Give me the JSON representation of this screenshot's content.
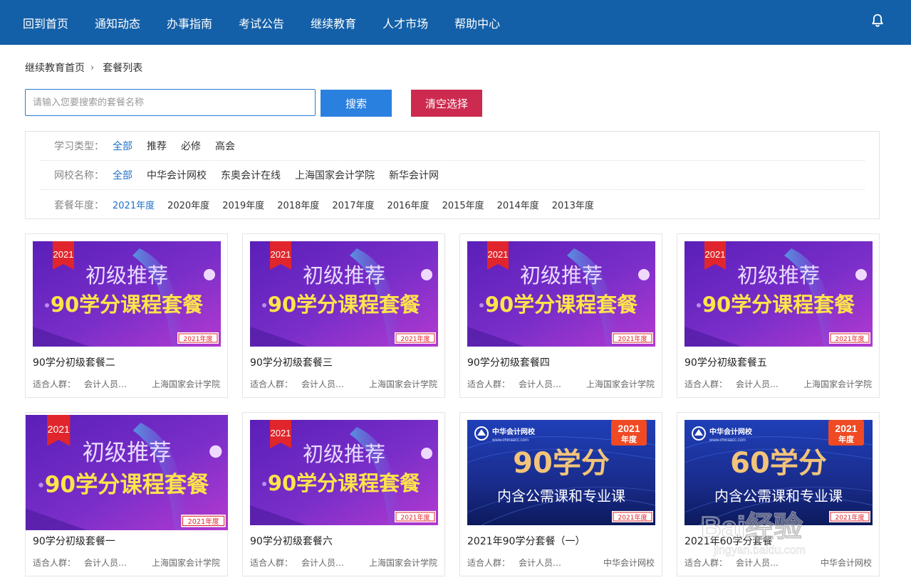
{
  "nav": {
    "items": [
      "回到首页",
      "通知动态",
      "办事指南",
      "考试公告",
      "继续教育",
      "人才市场",
      "帮助中心"
    ]
  },
  "breadcrumb": {
    "home": "继续教育首页",
    "current": "套餐列表"
  },
  "search": {
    "placeholder": "请输入您要搜索的套餐名称",
    "value": "",
    "button": "搜索",
    "clear": "清空选择"
  },
  "filters": {
    "type": {
      "label": "学习类型：",
      "options": [
        "全部",
        "推荐",
        "必修",
        "高会"
      ],
      "active": 0
    },
    "school": {
      "label": "网校名称：",
      "options": [
        "全部",
        "中华会计网校",
        "东奥会计在线",
        "上海国家会计学院",
        "新华会计网"
      ],
      "active": 0
    },
    "year": {
      "label": "套餐年度：",
      "options": [
        "2021年度",
        "2020年度",
        "2019年度",
        "2018年度",
        "2017年度",
        "2016年度",
        "2015年度",
        "2014年度",
        "2013年度"
      ],
      "active": 0
    }
  },
  "audience_label": "适合人群：",
  "banners": {
    "purple": {
      "ribbon": "2021",
      "line1": "初级推荐",
      "line2": "90学分课程套餐",
      "tag": "2021年度"
    },
    "blue90": {
      "brand": "中华会计网校",
      "site": "www.chinaacc.com",
      "year": "2021",
      "year2": "年度",
      "big": "90学分",
      "sub": "内含公需课和专业课",
      "tag": "2021年度"
    },
    "blue60": {
      "brand": "中华会计网校",
      "site": "www.chinaacc.com",
      "year": "2021",
      "year2": "年度",
      "big": "60学分",
      "sub": "内含公需课和专业课",
      "tag": "2021年度"
    }
  },
  "cards": [
    {
      "title": "90学分初级套餐二",
      "audience": "会计人员…",
      "school": "上海国家会计学院"
    },
    {
      "title": "90学分初级套餐三",
      "audience": "会计人员…",
      "school": "上海国家会计学院"
    },
    {
      "title": "90学分初级套餐四",
      "audience": "会计人员…",
      "school": "上海国家会计学院"
    },
    {
      "title": "90学分初级套餐五",
      "audience": "会计人员…",
      "school": "上海国家会计学院"
    },
    {
      "title": "90学分初级套餐一",
      "audience": "会计人员…",
      "school": "上海国家会计学院"
    },
    {
      "title": "90学分初级套餐六",
      "audience": "会计人员…",
      "school": "上海国家会计学院"
    },
    {
      "title": "2021年90学分套餐（一）",
      "audience": "会计人员…",
      "school": "中华会计网校"
    },
    {
      "title": "2021年60学分套餐",
      "audience": "会计人员…",
      "school": "中华会计网校"
    }
  ],
  "watermark": {
    "text": "Bai经验",
    "url": "jingyan.baidu.com"
  },
  "colors": {
    "nav_bg": "#1460a8",
    "search_btn": "#2a80df",
    "clear_btn": "#cc2a4e",
    "active_filter": "#1e6fc6"
  }
}
